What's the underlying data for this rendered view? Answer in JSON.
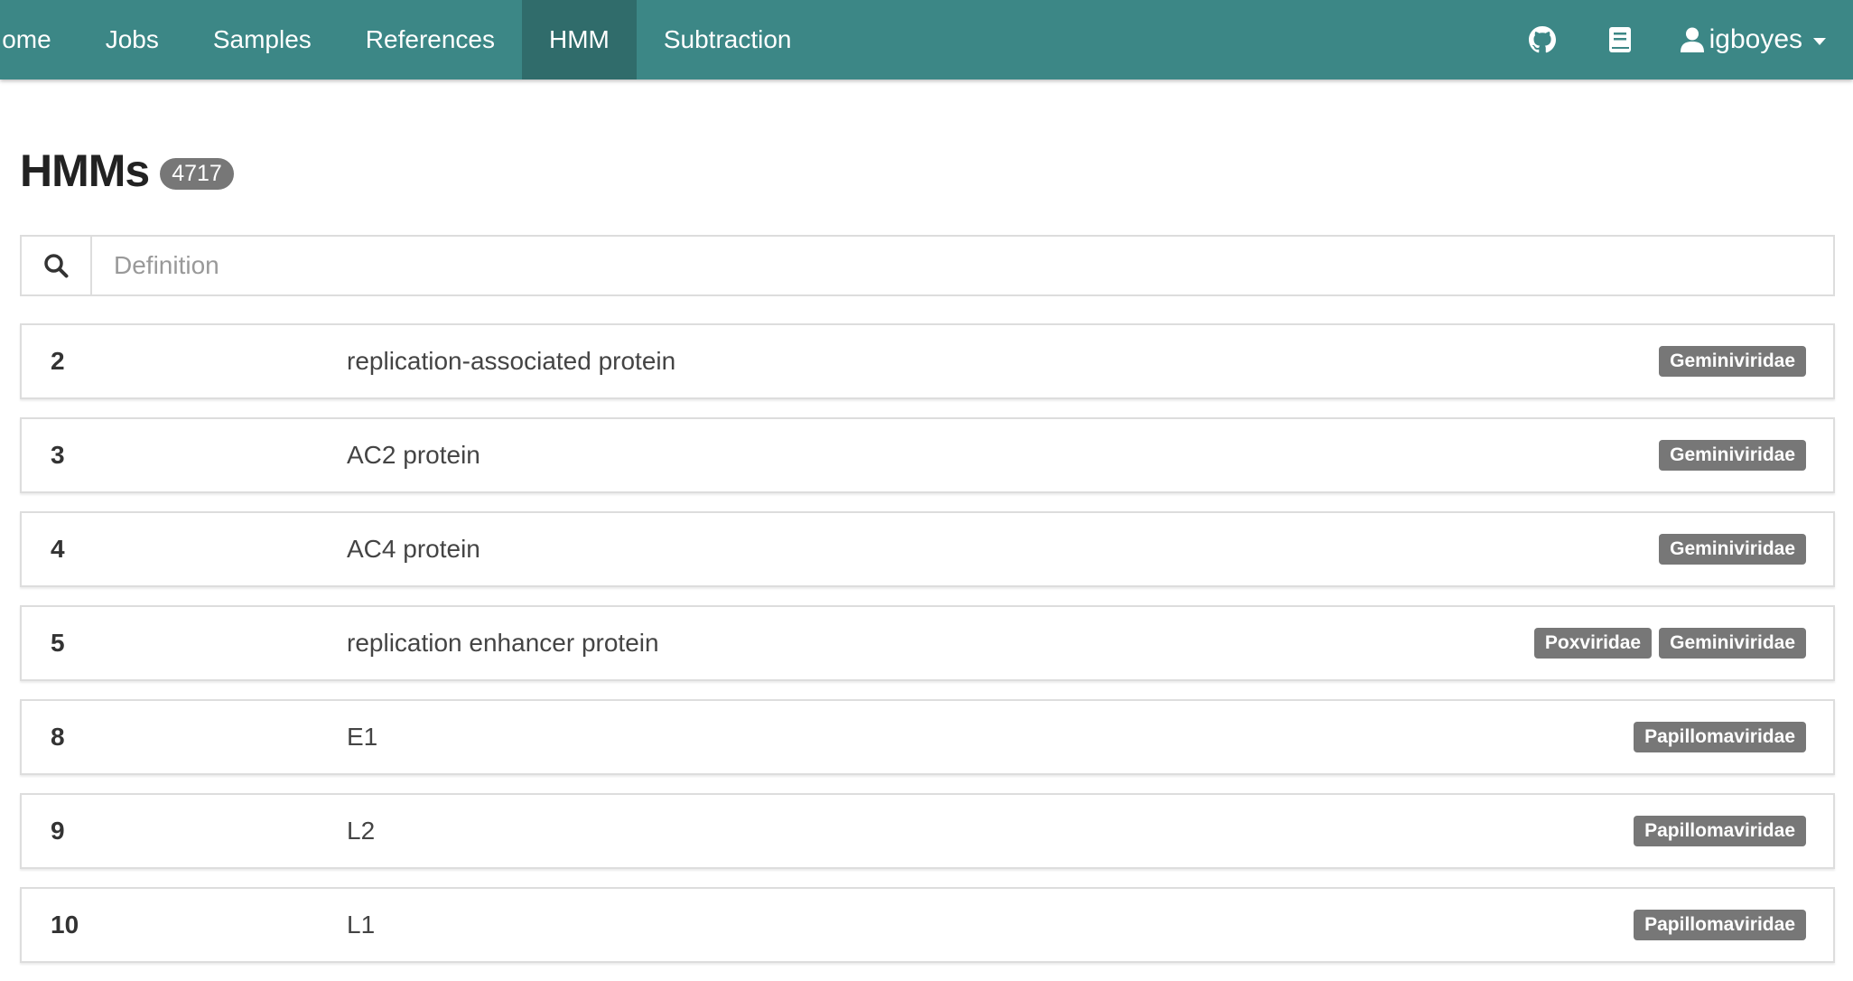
{
  "navbar": {
    "items": [
      {
        "label": "Home"
      },
      {
        "label": "Jobs"
      },
      {
        "label": "Samples"
      },
      {
        "label": "References"
      },
      {
        "label": "HMM",
        "active": true
      },
      {
        "label": "Subtraction"
      }
    ],
    "icons": {
      "github": "github-icon",
      "docs": "book-icon"
    },
    "user": {
      "name": "igboyes",
      "icon": "user-icon"
    }
  },
  "header": {
    "title": "HMMs",
    "count": "4717"
  },
  "search": {
    "placeholder": "Definition",
    "value": "",
    "icon": "search-icon"
  },
  "hmms": [
    {
      "id": "2",
      "definition": "replication-associated protein",
      "families": [
        "Geminiviridae"
      ]
    },
    {
      "id": "3",
      "definition": "AC2 protein",
      "families": [
        "Geminiviridae"
      ]
    },
    {
      "id": "4",
      "definition": "AC4 protein",
      "families": [
        "Geminiviridae"
      ]
    },
    {
      "id": "5",
      "definition": "replication enhancer protein",
      "families": [
        "Poxviridae",
        "Geminiviridae"
      ]
    },
    {
      "id": "8",
      "definition": "E1",
      "families": [
        "Papillomaviridae"
      ]
    },
    {
      "id": "9",
      "definition": "L2",
      "families": [
        "Papillomaviridae"
      ]
    },
    {
      "id": "10",
      "definition": "L1",
      "families": [
        "Papillomaviridae"
      ]
    }
  ],
  "colors": {
    "navbar": "#3c8786",
    "navbar_active": "#306c6b",
    "badge": "#777777"
  }
}
